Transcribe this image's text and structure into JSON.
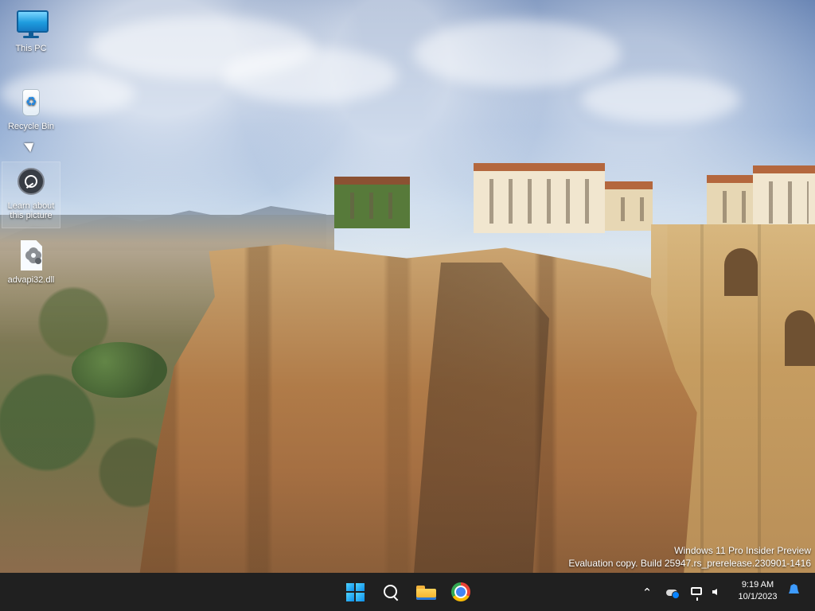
{
  "desktop": {
    "icons": [
      {
        "label": "This PC",
        "icon": "monitor-icon"
      },
      {
        "label": "Recycle Bin",
        "icon": "recycle-bin-icon"
      },
      {
        "label": "Learn about\nthis picture",
        "icon": "camera-info-icon"
      },
      {
        "label": "advapi32.dll",
        "icon": "settings-file-icon"
      }
    ],
    "watermark": {
      "line1": "Windows 11 Pro Insider Preview",
      "line2": "Evaluation copy. Build 25947.rs_prerelease.230901-1416"
    }
  },
  "taskbar": {
    "apps": [
      {
        "name": "Start",
        "icon": "windows-start-icon"
      },
      {
        "name": "Search",
        "icon": "search-icon"
      },
      {
        "name": "File Explorer",
        "icon": "folder-icon"
      },
      {
        "name": "Google Chrome",
        "icon": "chrome-icon"
      }
    ],
    "tray": {
      "icons": [
        "chevron-up-icon",
        "onedrive-icon",
        "network-icon",
        "volume-muted-icon",
        "notification-bell-icon"
      ],
      "time": "9:19 AM",
      "date": "10/1/2023"
    }
  }
}
